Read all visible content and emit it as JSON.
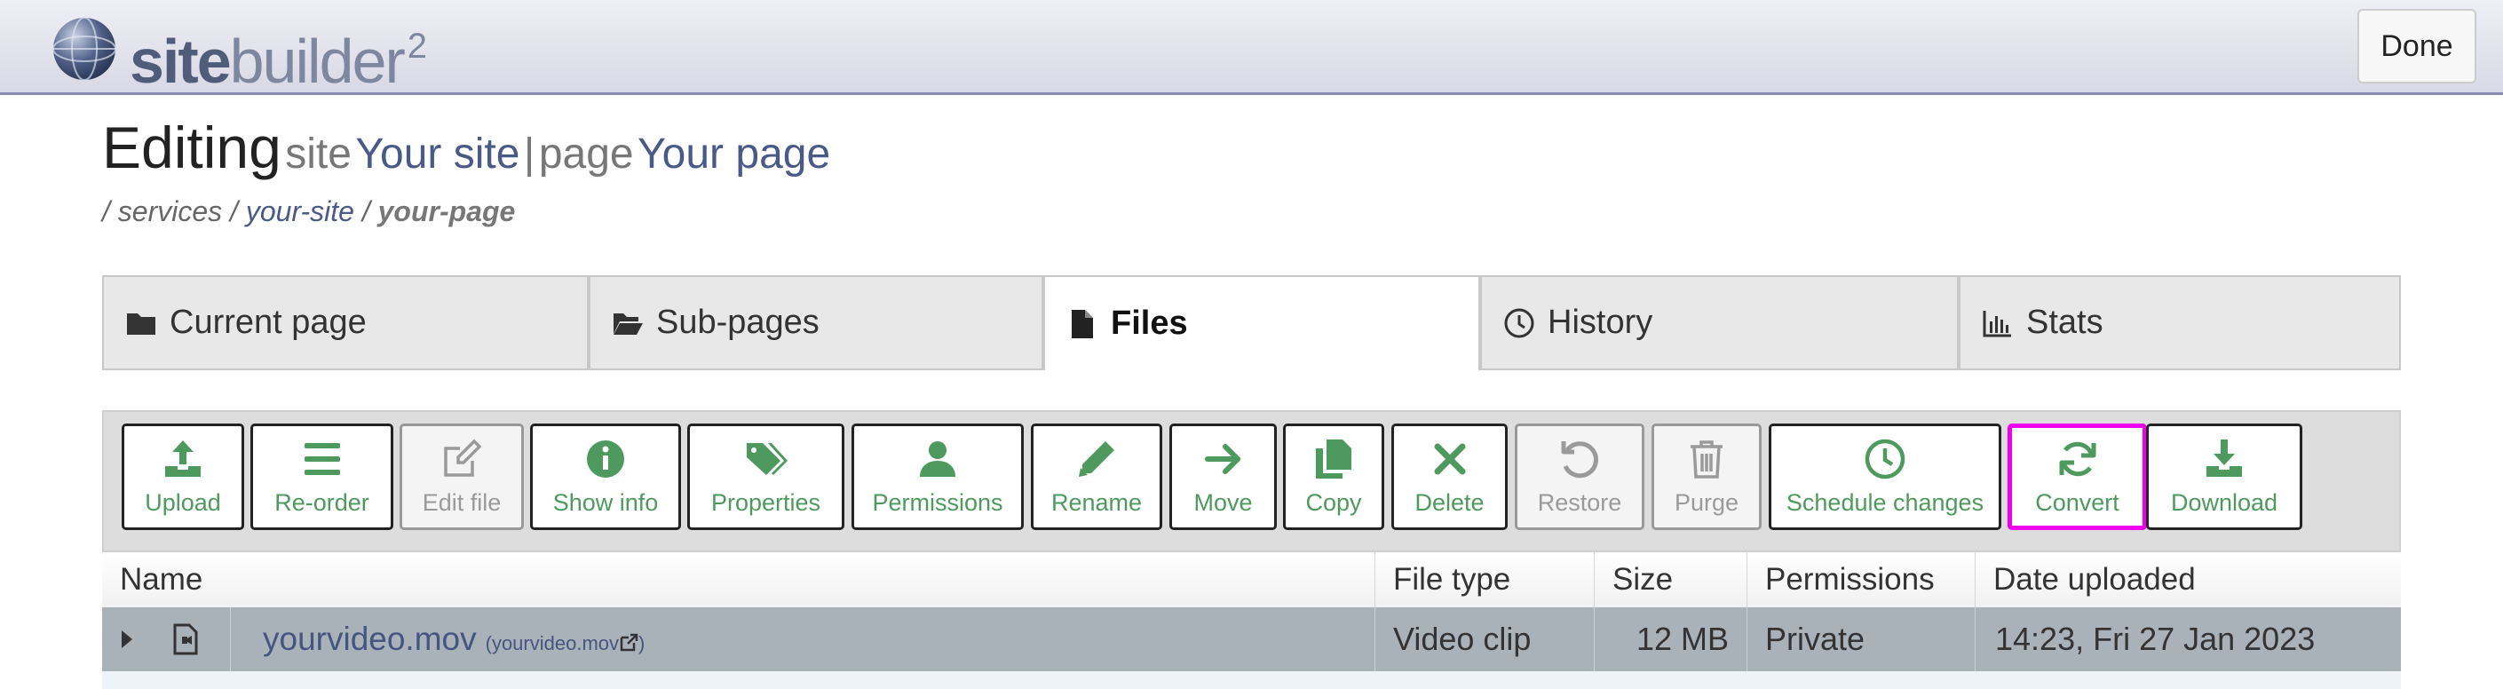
{
  "app": {
    "logo_bold": "site",
    "logo_light": "builder",
    "logo_sup": "2",
    "done_label": "Done"
  },
  "heading": {
    "editing": "Editing",
    "site_word": "site",
    "site_name": "Your site",
    "separator": "|",
    "page_word": "page",
    "page_name": "Your page"
  },
  "breadcrumb": {
    "sep": "/",
    "services": "services",
    "site": "your-site",
    "page": "your-page"
  },
  "tabs": [
    {
      "label": "Current page",
      "icon": "folder-icon"
    },
    {
      "label": "Sub-pages",
      "icon": "folder-open-icon"
    },
    {
      "label": "Files",
      "icon": "file-icon",
      "active": true
    },
    {
      "label": "History",
      "icon": "clock-icon"
    },
    {
      "label": "Stats",
      "icon": "bar-chart-icon"
    }
  ],
  "toolbar": [
    {
      "label": "Upload",
      "icon": "upload-icon",
      "enabled": true
    },
    {
      "label": "Re-order",
      "icon": "bars-icon",
      "enabled": true
    },
    {
      "label": "Edit file",
      "icon": "edit-icon",
      "enabled": false
    },
    {
      "label": "Show info",
      "icon": "info-icon",
      "enabled": true
    },
    {
      "label": "Properties",
      "icon": "tags-icon",
      "enabled": true
    },
    {
      "label": "Permissions",
      "icon": "user-icon",
      "enabled": true
    },
    {
      "label": "Rename",
      "icon": "pencil-icon",
      "enabled": true
    },
    {
      "label": "Move",
      "icon": "arrow-right-icon",
      "enabled": true
    },
    {
      "label": "Copy",
      "icon": "copy-icon",
      "enabled": true
    },
    {
      "label": "Delete",
      "icon": "times-icon",
      "enabled": true
    },
    {
      "label": "Restore",
      "icon": "undo-icon",
      "enabled": false
    },
    {
      "label": "Purge",
      "icon": "trash-icon",
      "enabled": false
    },
    {
      "label": "Schedule changes",
      "icon": "clock-icon",
      "enabled": true
    },
    {
      "label": "Convert",
      "icon": "refresh-icon",
      "enabled": true,
      "highlighted": true
    },
    {
      "label": "Download",
      "icon": "download-icon",
      "enabled": true
    }
  ],
  "table": {
    "columns": [
      "Name",
      "File type",
      "Size",
      "Permissions",
      "Date uploaded"
    ],
    "rows": [
      {
        "name": "yourvideo.mov",
        "name_link": "(yourvideo.mov",
        "name_link_close": ")",
        "file_type": "Video clip",
        "size": "12 MB",
        "permissions": "Private",
        "date": "14:23, Fri 27 Jan 2023"
      }
    ]
  },
  "colors": {
    "accent_green": "#4e9a5e",
    "link_blue": "#4a5a86",
    "highlight_magenta": "#ee00ee",
    "selected_row": "#aab2b9"
  }
}
